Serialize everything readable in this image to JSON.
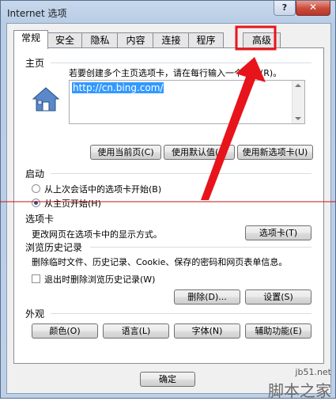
{
  "window": {
    "title": "Internet 选项",
    "help": "?",
    "close": "✕"
  },
  "tabs": [
    "常规",
    "安全",
    "隐私",
    "内容",
    "连接",
    "程序",
    "高级"
  ],
  "home": {
    "label": "主页",
    "desc": "若要创建多个主页选项卡，请在每行输入一个地址(R)。",
    "url": "http://cn.bing.com/",
    "btn_current": "使用当前页(C)",
    "btn_default": "使用默认值(F)",
    "btn_newtab": "使用新选项卡(U)"
  },
  "startup": {
    "label": "启动",
    "opt_last": "从上次会话中的选项卡开始(B)",
    "opt_home": "从主页开始(H)"
  },
  "tabs_section": {
    "label": "选项卡",
    "desc": "更改网页在选项卡中的显示方式。",
    "btn": "选项卡(T)"
  },
  "history": {
    "label": "浏览历史记录",
    "desc": "删除临时文件、历史记录、Cookie、保存的密码和网页表单信息。",
    "checkbox": "退出时删除浏览历史记录(W)",
    "btn_delete": "删除(D)...",
    "btn_settings": "设置(S)"
  },
  "appearance": {
    "label": "外观",
    "btn_colors": "颜色(O)",
    "btn_languages": "语言(L)",
    "btn_fonts": "字体(N)",
    "btn_accessibility": "辅助功能(E)"
  },
  "footer": {
    "ok": "确定"
  },
  "watermark": {
    "url": "jb51.net",
    "site": "脚本之家"
  },
  "colors": {
    "annotation": "#e8141b"
  }
}
